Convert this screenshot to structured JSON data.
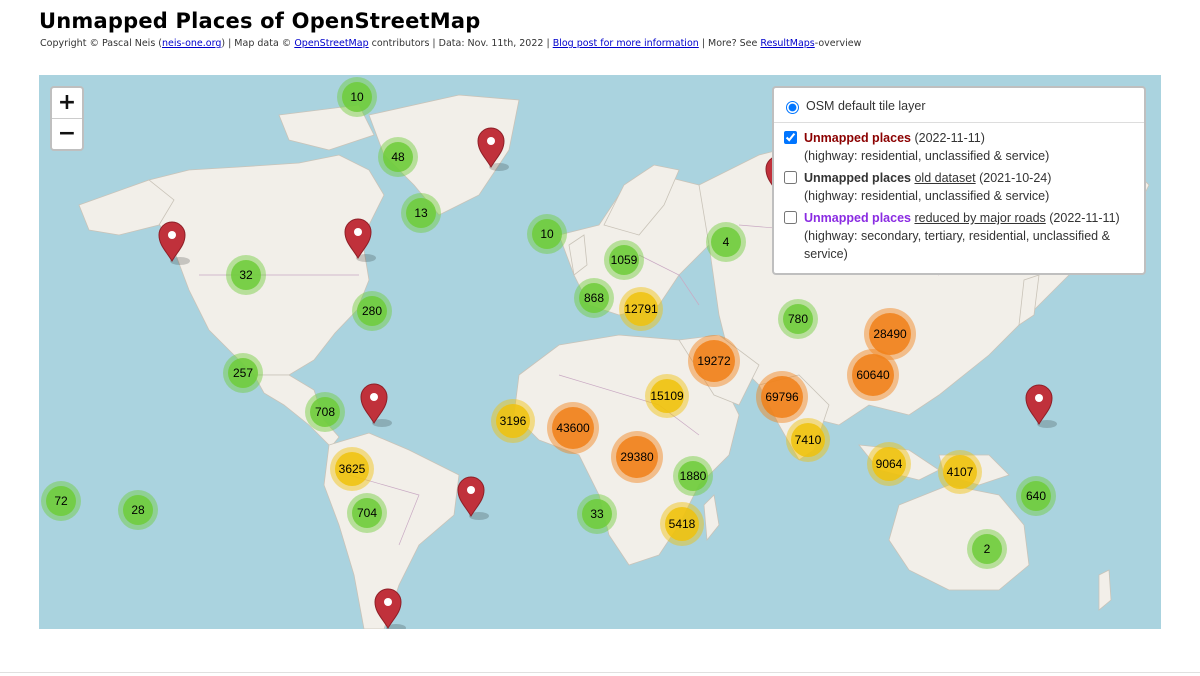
{
  "title": "Unmapped Places of OpenStreetMap",
  "credits": {
    "copyright": "Copyright © Pascal Neis (",
    "author_link": "neis-one.org",
    "map_data": ") | Map data © ",
    "osm_link": "OpenStreetMap",
    "contributors": " contributors | Data: Nov. 11th, 2022 | ",
    "blog_link": "Blog post for more information",
    "more": " | More? See ",
    "resultmaps_link": "ResultMaps",
    "overview": "-overview"
  },
  "zoom": {
    "in": "+",
    "out": "−"
  },
  "layers": {
    "base": "OSM default tile layer",
    "overlays": [
      {
        "name": "Unmapped places",
        "extra": "",
        "date": " (2022-11-11)",
        "desc": "(highway: residential, unclassified & service)",
        "checked": true,
        "color": "#8b0000"
      },
      {
        "name": "Unmapped places",
        "extra": "old dataset",
        "date": " (2021-10-24)",
        "desc": "(highway: residential, unclassified & service)",
        "checked": false,
        "color": "#333333"
      },
      {
        "name": "Unmapped places",
        "extra": "reduced by major roads",
        "date": " (2022-11-11)",
        "desc": "(highway: secondary, tertiary, residential, unclassified & service)",
        "checked": false,
        "color": "#8a2be2"
      }
    ]
  },
  "cluster_colors": {
    "small": "#6ecc39",
    "medium": "#f0c20c",
    "large": "#f18017"
  },
  "clusters": [
    {
      "label": "10",
      "size": "small"
    },
    {
      "label": "48",
      "size": "small"
    },
    {
      "label": "13",
      "size": "small"
    },
    {
      "label": "32",
      "size": "small"
    },
    {
      "label": "280",
      "size": "small"
    },
    {
      "label": "257",
      "size": "small"
    },
    {
      "label": "708",
      "size": "small"
    },
    {
      "label": "3625",
      "size": "medium"
    },
    {
      "label": "704",
      "size": "small"
    },
    {
      "label": "72",
      "size": "small"
    },
    {
      "label": "28",
      "size": "small"
    },
    {
      "label": "10",
      "size": "small"
    },
    {
      "label": "1059",
      "size": "small"
    },
    {
      "label": "868",
      "size": "small"
    },
    {
      "label": "12791",
      "size": "medium"
    },
    {
      "label": "4",
      "size": "small"
    },
    {
      "label": "780",
      "size": "small"
    },
    {
      "label": "28490",
      "size": "large"
    },
    {
      "label": "19272",
      "size": "large"
    },
    {
      "label": "60640",
      "size": "large"
    },
    {
      "label": "15109",
      "size": "medium"
    },
    {
      "label": "69796",
      "size": "large"
    },
    {
      "label": "3196",
      "size": "medium"
    },
    {
      "label": "43600",
      "size": "large"
    },
    {
      "label": "29380",
      "size": "large"
    },
    {
      "label": "7410",
      "size": "medium"
    },
    {
      "label": "1880",
      "size": "small"
    },
    {
      "label": "9064",
      "size": "medium"
    },
    {
      "label": "4107",
      "size": "medium"
    },
    {
      "label": "640",
      "size": "small"
    },
    {
      "label": "33",
      "size": "small"
    },
    {
      "label": "5418",
      "size": "medium"
    },
    {
      "label": "2",
      "size": "small"
    }
  ],
  "pin_icon": "map-marker-icon",
  "pin_color": "#c0313b"
}
